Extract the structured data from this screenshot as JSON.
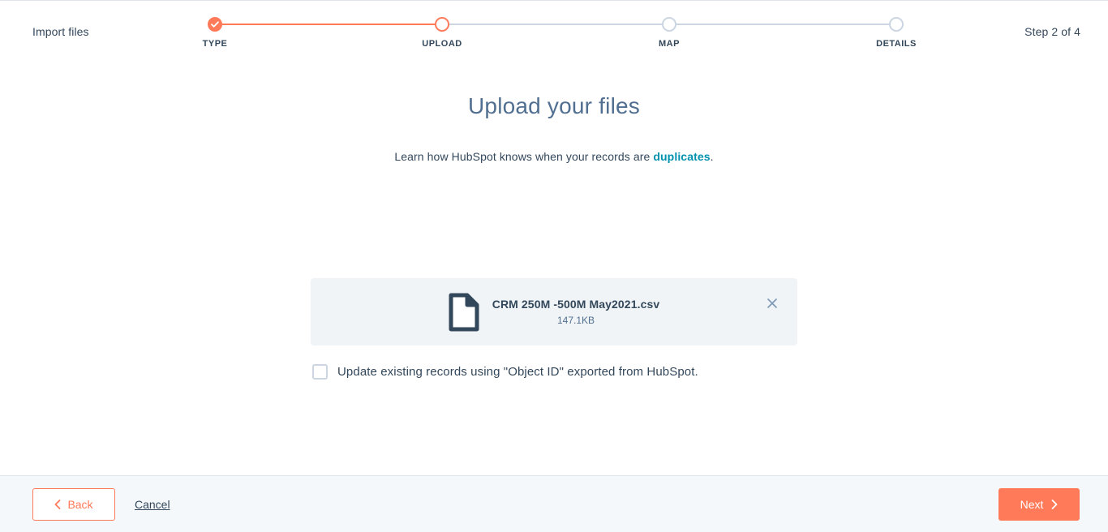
{
  "header": {
    "title": "Import files",
    "step_counter": "Step 2 of 4"
  },
  "stepper": {
    "steps": [
      {
        "label": "TYPE",
        "state": "done"
      },
      {
        "label": "UPLOAD",
        "state": "current"
      },
      {
        "label": "MAP",
        "state": "upcoming"
      },
      {
        "label": "DETAILS",
        "state": "upcoming"
      }
    ],
    "colors": {
      "active": "#ff7a59",
      "inactive": "#cbd6e2"
    }
  },
  "main": {
    "page_title": "Upload your files",
    "subtitle_prefix": "Learn how HubSpot knows when your records are ",
    "subtitle_link": "duplicates",
    "subtitle_suffix": ".",
    "link_color": "#0091ae",
    "file": {
      "name": "CRM 250M -500M May2021.csv",
      "size": "147.1KB",
      "icon": "document-icon",
      "remove_icon": "close-icon"
    },
    "checkbox": {
      "label": "Update existing records using \"Object ID\" exported from HubSpot.",
      "checked": false
    }
  },
  "footer": {
    "back_label": "Back",
    "cancel_label": "Cancel",
    "next_label": "Next",
    "back_icon": "chevron-left-icon",
    "next_icon": "chevron-right-icon",
    "primary_color": "#ff7a59"
  }
}
